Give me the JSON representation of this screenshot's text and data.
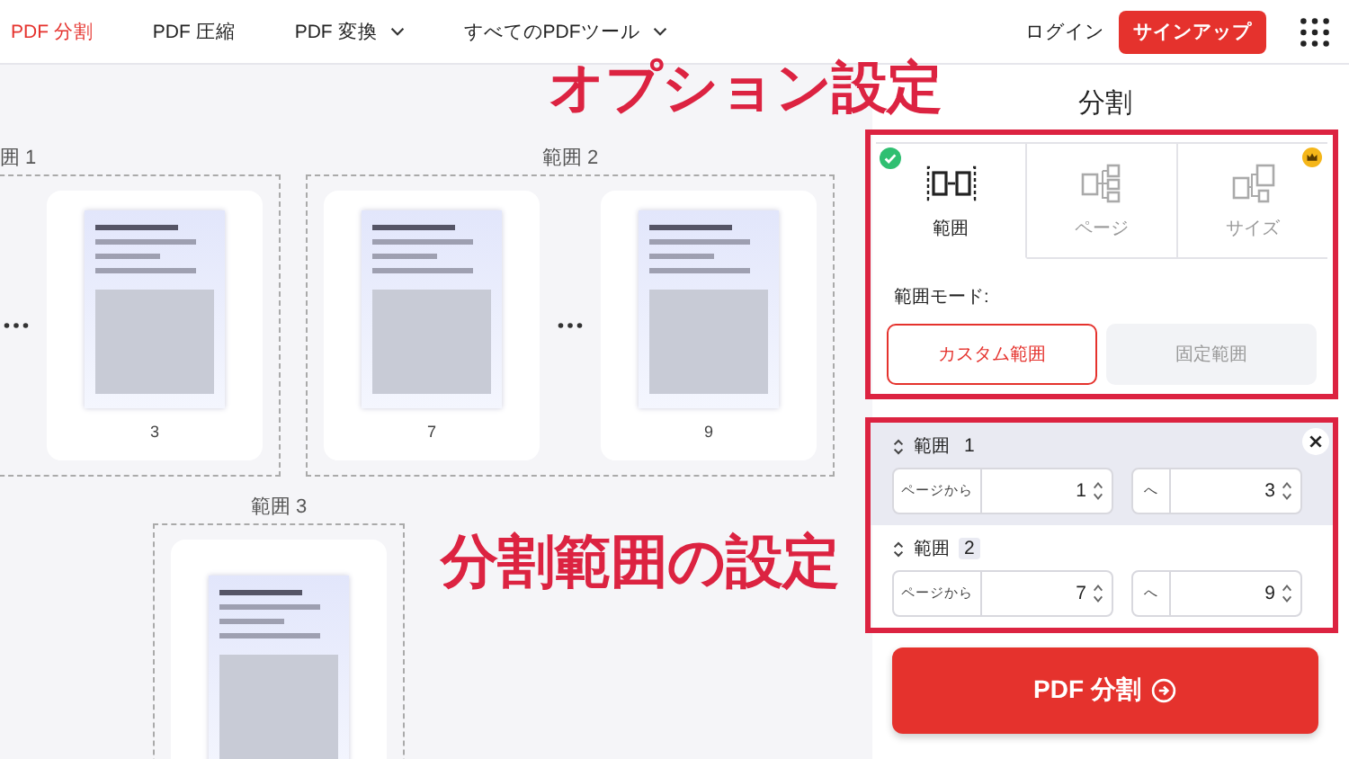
{
  "nav": {
    "items": [
      {
        "label": "PDF 分割",
        "selected": true,
        "dropdown": false
      },
      {
        "label": "PDF 圧縮",
        "selected": false,
        "dropdown": false
      },
      {
        "label": "PDF 変換",
        "selected": false,
        "dropdown": true
      },
      {
        "label": "すべてのPDFツール",
        "selected": false,
        "dropdown": true
      }
    ],
    "login": "ログイン",
    "signup": "サインアップ"
  },
  "canvas": {
    "groups": [
      {
        "label": "囲 1",
        "pages": [
          {
            "kind": "ellipsis"
          },
          {
            "kind": "page",
            "number": "3"
          }
        ]
      },
      {
        "label": "範囲 2",
        "pages": [
          {
            "kind": "page",
            "number": "7"
          },
          {
            "kind": "ellipsis"
          },
          {
            "kind": "page",
            "number": "9"
          }
        ]
      },
      {
        "label": "範囲 3",
        "pages": [
          {
            "kind": "page"
          }
        ]
      }
    ]
  },
  "panel": {
    "title": "分割",
    "tabs": [
      {
        "label": "範囲",
        "kind": "range",
        "selected": true,
        "premium": false
      },
      {
        "label": "ページ",
        "kind": "pages",
        "selected": false,
        "premium": false
      },
      {
        "label": "サイズ",
        "kind": "size",
        "selected": false,
        "premium": true
      }
    ],
    "mode_label": "範囲モード:",
    "modes": [
      {
        "label": "カスタム範囲",
        "selected": true
      },
      {
        "label": "固定範囲",
        "selected": false
      }
    ],
    "ranges": [
      {
        "title": "範囲",
        "index": "1",
        "highlighted": true,
        "removable": true,
        "from_label": "ページから",
        "from": "1",
        "to_label": "へ",
        "to": "3"
      },
      {
        "title": "範囲",
        "index": "2",
        "highlighted": false,
        "removable": false,
        "from_label": "ページから",
        "from": "7",
        "to_label": "へ",
        "to": "9"
      }
    ],
    "submit": "PDF 分割"
  },
  "annotations": [
    {
      "text": "オプション設定"
    },
    {
      "text": "分割範囲の設定"
    }
  ]
}
